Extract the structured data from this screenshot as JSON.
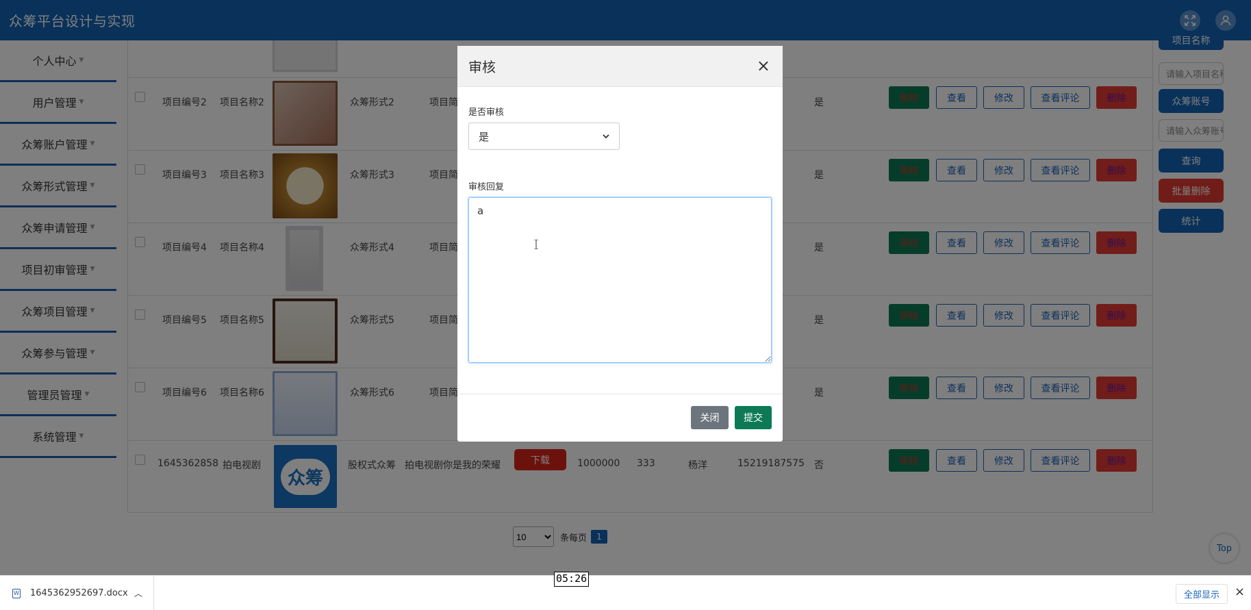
{
  "app": {
    "title": "众筹平台设计与实现"
  },
  "sidebar": {
    "items": [
      {
        "label": "个人中心"
      },
      {
        "label": "用户管理"
      },
      {
        "label": "众筹账户管理"
      },
      {
        "label": "众筹形式管理"
      },
      {
        "label": "众筹申请管理"
      },
      {
        "label": "项目初审管理"
      },
      {
        "label": "众筹项目管理"
      },
      {
        "label": "众筹参与管理"
      },
      {
        "label": "管理员管理"
      },
      {
        "label": "系统管理"
      }
    ]
  },
  "search": {
    "project_name_btn": "项目名称",
    "project_name_placeholder": "请输入项目名称",
    "account_btn": "众筹账号",
    "account_placeholder": "请输入众筹账号",
    "query_btn": "查询",
    "batch_delete_btn": "批量删除",
    "stats_btn": "统计"
  },
  "table": {
    "actions": {
      "audit": "审核",
      "view": "查看",
      "edit": "修改",
      "comments": "查看评论",
      "delete": "删除",
      "download": "下载"
    },
    "rows": [
      {
        "id": "项目编号2",
        "name": "项目名称2",
        "form": "众筹形式2",
        "intro": "项目简",
        "status": "是"
      },
      {
        "id": "项目编号3",
        "name": "项目名称3",
        "form": "众筹形式3",
        "intro": "项目简",
        "status": "是"
      },
      {
        "id": "项目编号4",
        "name": "项目名称4",
        "form": "众筹形式4",
        "intro": "项目简",
        "status": "是"
      },
      {
        "id": "项目编号5",
        "name": "项目名称5",
        "form": "众筹形式5",
        "intro": "项目简",
        "status": "是"
      },
      {
        "id": "项目编号6",
        "name": "项目名称6",
        "form": "众筹形式6",
        "intro": "项目简",
        "status": "是"
      },
      {
        "id": "1645362858",
        "name": "拍电视剧",
        "form": "股权式众筹",
        "intro": "拍电视剧你是我的荣耀",
        "amount": "1000000",
        "count": "333",
        "person": "杨洋",
        "phone": "15219187575",
        "status": "否",
        "logo": "众筹"
      }
    ]
  },
  "pagination": {
    "page_size": "10",
    "per_page_label": "条每页",
    "current_page": "1"
  },
  "top_button": "Top",
  "modal": {
    "title": "审核",
    "close_symbol": "×",
    "audit_label": "是否审核",
    "audit_value": "是",
    "reply_label": "审核回复",
    "reply_value": "a",
    "close_btn": "关闭",
    "submit_btn": "提交"
  },
  "download_bar": {
    "filename": "1645362952697.docx",
    "show_all": "全部显示",
    "close_symbol": "×"
  },
  "time_overlay": "05:26",
  "colors": {
    "primary": "#1262b4",
    "success": "#0d7a55",
    "danger": "#e33b34",
    "secondary": "#6c757d"
  }
}
